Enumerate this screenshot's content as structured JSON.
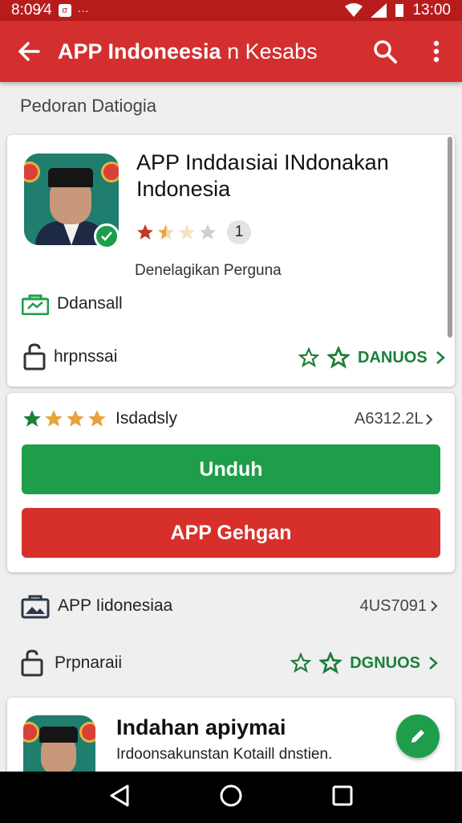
{
  "status_bar": {
    "left_time": "8:09⁄4",
    "right_time": "13:00",
    "notification_glyph": "σ",
    "more": "···"
  },
  "app_bar": {
    "title_main": "APP Indoneesia",
    "title_rest": " n Kesabs"
  },
  "section_title": "Pedoran Datiogia",
  "app_card": {
    "name": "APP Inddaısiai INdonakan Indonesia",
    "rating_stars_filled": 1.5,
    "rating_count": "1",
    "subtitle": "Denelagikan Perguna",
    "category_label": "Ddansall",
    "size_label": "hrpnssai",
    "more_link": "DANUOS"
  },
  "action_card": {
    "rating_label": "Isdadsly",
    "stars_filled": 4,
    "version": "A6312.2L",
    "download_button": "Unduh",
    "secondary_button": "APP Gehgan"
  },
  "list_rows": {
    "row1_label": "APP Iidonesiaa",
    "row1_value": "4US7091",
    "row2_label": "Prpnaraii",
    "row2_link": "DGNUOS"
  },
  "bottom_card": {
    "title": "Indahan apiymai",
    "subtitle": "Irdoonsakunstan Kotaill dnstien."
  },
  "colors": {
    "primary": "#d32f2f",
    "status": "#b71c1c",
    "green": "#1e9e4a",
    "red": "#d7302b"
  }
}
